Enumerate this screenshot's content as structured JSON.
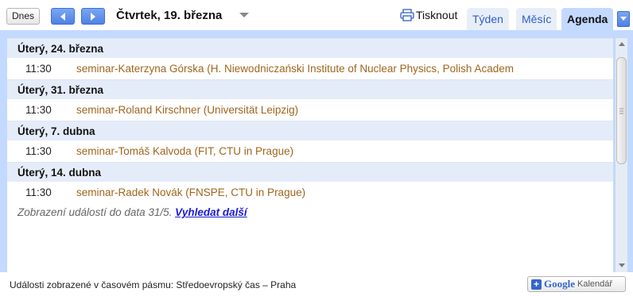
{
  "toolbar": {
    "today_label": "Dnes",
    "current_date": "Čtvrtek, 19. března",
    "print_label": "Tisknout",
    "tabs": [
      {
        "label": "Týden"
      },
      {
        "label": "Měsíc"
      },
      {
        "label": "Agenda"
      }
    ]
  },
  "days": [
    {
      "date": "Úterý, 24. března",
      "events": [
        {
          "time": "11:30",
          "title": "seminar-Katerzyna Górska (H. Niewodniczański Institute of Nuclear Physics, Polish Academ"
        }
      ]
    },
    {
      "date": "Úterý, 31. března",
      "events": [
        {
          "time": "11:30",
          "title": "seminar-Roland Kirschner (Universität Leipzig)"
        }
      ]
    },
    {
      "date": "Úterý, 7. dubna",
      "events": [
        {
          "time": "11:30",
          "title": "seminar-Tomáš Kalvoda (FIT, CTU in Prague)"
        }
      ]
    },
    {
      "date": "Úterý, 14. dubna",
      "events": [
        {
          "time": "11:30",
          "title": "seminar-Radek Novák (FNSPE, CTU in Prague)"
        }
      ]
    }
  ],
  "footer_note": {
    "text": "Zobrazení událostí do data 31/5. ",
    "link": "Vyhledat další"
  },
  "timezone_text": "Události zobrazené v časovém pásmu: Středoevropský čas – Praha",
  "badge": {
    "plus": "+",
    "google": "Google",
    "calendar": "Kalendář"
  },
  "colors": {
    "accent": "#c3d9ff",
    "event_title": "#a0651e",
    "link": "#1a1ad6"
  },
  "icons": [
    "chevron-left-icon",
    "chevron-right-icon",
    "caret-down-icon",
    "printer-icon",
    "scroll-up-icon",
    "scroll-down-icon"
  ]
}
